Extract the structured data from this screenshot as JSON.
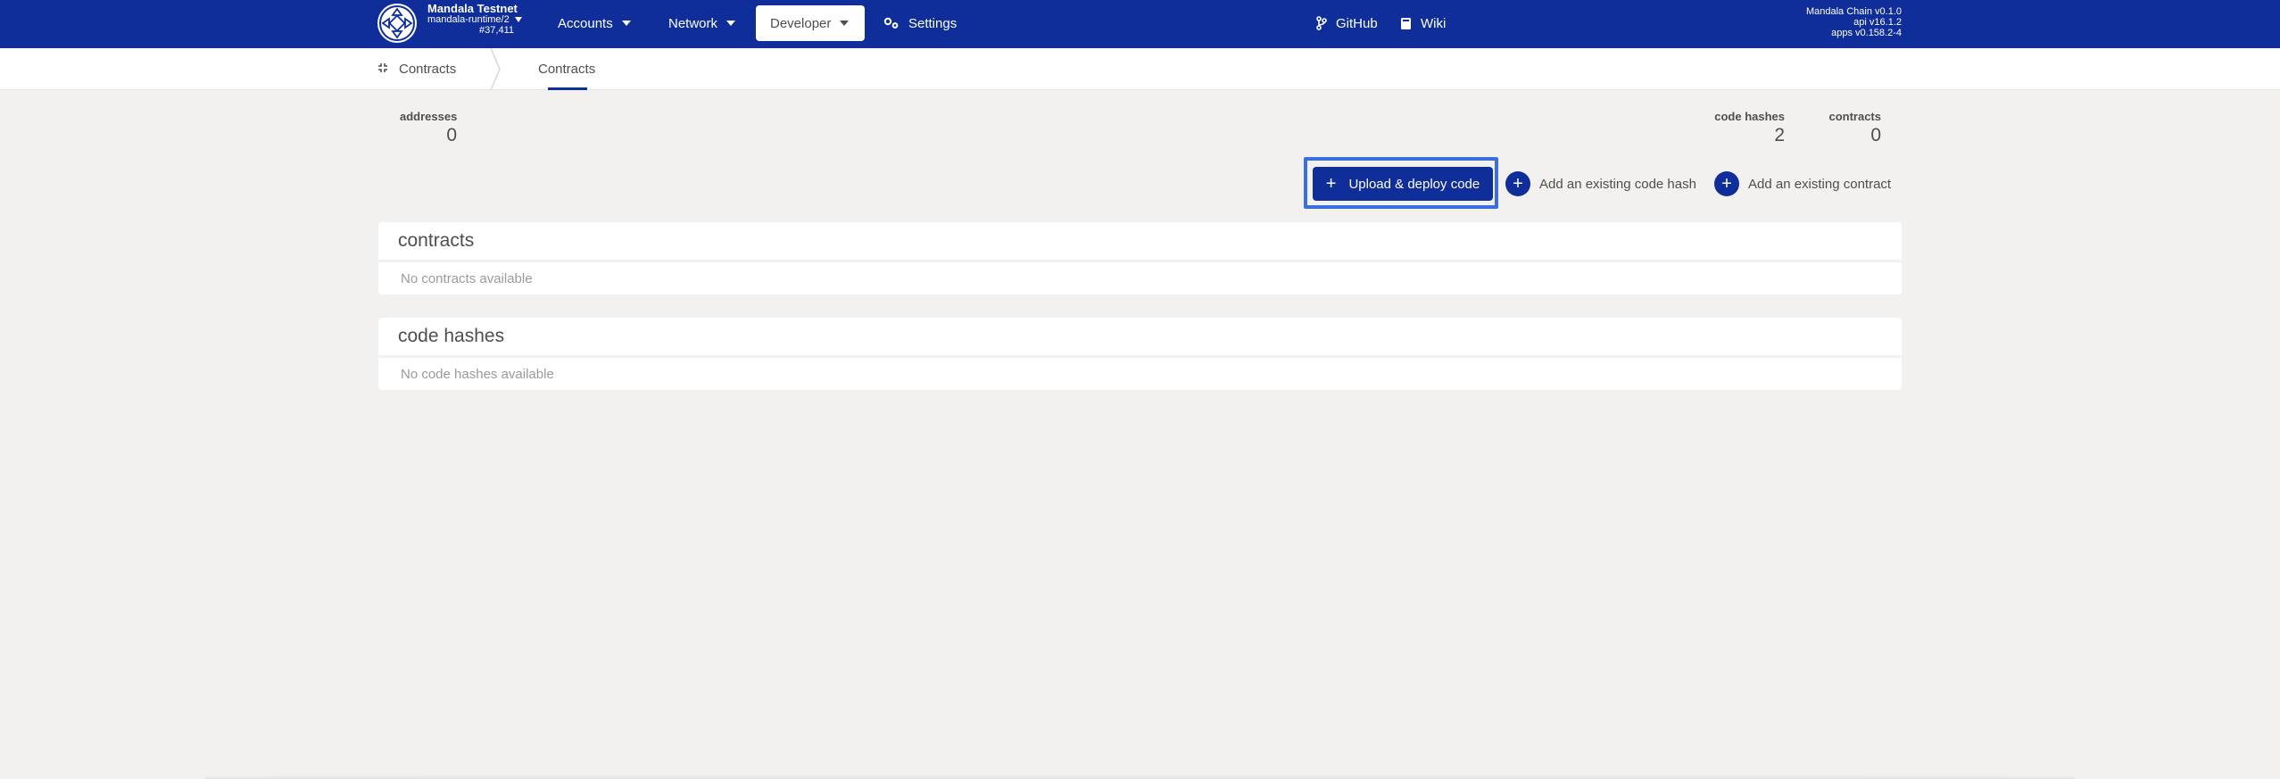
{
  "header": {
    "chain_name": "Mandala Testnet",
    "runtime": "mandala-runtime/2",
    "block": "#37,411",
    "menu": {
      "accounts": "Accounts",
      "network": "Network",
      "developer": "Developer",
      "settings": "Settings",
      "github": "GitHub",
      "wiki": "Wiki"
    },
    "versions": {
      "chain": "Mandala Chain v0.1.0",
      "api": "api v16.1.2",
      "apps": "apps v0.158.2-4"
    }
  },
  "tabs": {
    "root": "Contracts",
    "active": "Contracts"
  },
  "summary": {
    "addresses_label": "addresses",
    "addresses_value": "0",
    "code_hashes_label": "code hashes",
    "code_hashes_value": "2",
    "contracts_label": "contracts",
    "contracts_value": "0"
  },
  "actions": {
    "upload": "Upload & deploy code",
    "add_code_hash": "Add an existing code hash",
    "add_contract": "Add an existing contract"
  },
  "sections": {
    "contracts": {
      "title": "contracts",
      "empty": "No contracts available"
    },
    "code_hashes": {
      "title": "code hashes",
      "empty": "No code hashes available"
    }
  },
  "colors": {
    "brand": "#0f2e9a",
    "focus": "#3b6fe0",
    "background": "#f2f1ef"
  },
  "icons": [
    "chain-logo-icon",
    "chevron-down-icon",
    "gears-icon",
    "branch-icon",
    "book-icon",
    "contracts-tab-icon",
    "plus-icon"
  ]
}
